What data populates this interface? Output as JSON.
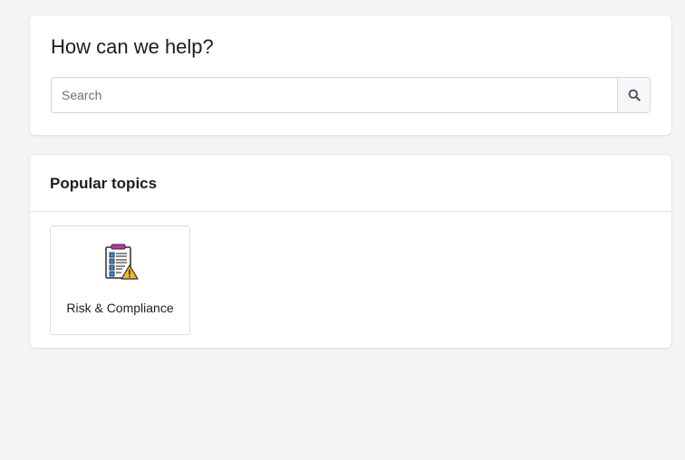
{
  "help": {
    "title": "How can we help?",
    "search_placeholder": "Search",
    "search_icon": "search-icon"
  },
  "popular": {
    "title": "Popular topics",
    "topics": [
      {
        "label": "Risk & Compliance",
        "icon": "clipboard-warning-icon"
      }
    ]
  },
  "colors": {
    "background": "#f4f4f6",
    "card": "#ffffff",
    "clipboard_clip": "#c2389a",
    "checkbox": "#2e8fd6",
    "warning": "#f5b52e"
  }
}
